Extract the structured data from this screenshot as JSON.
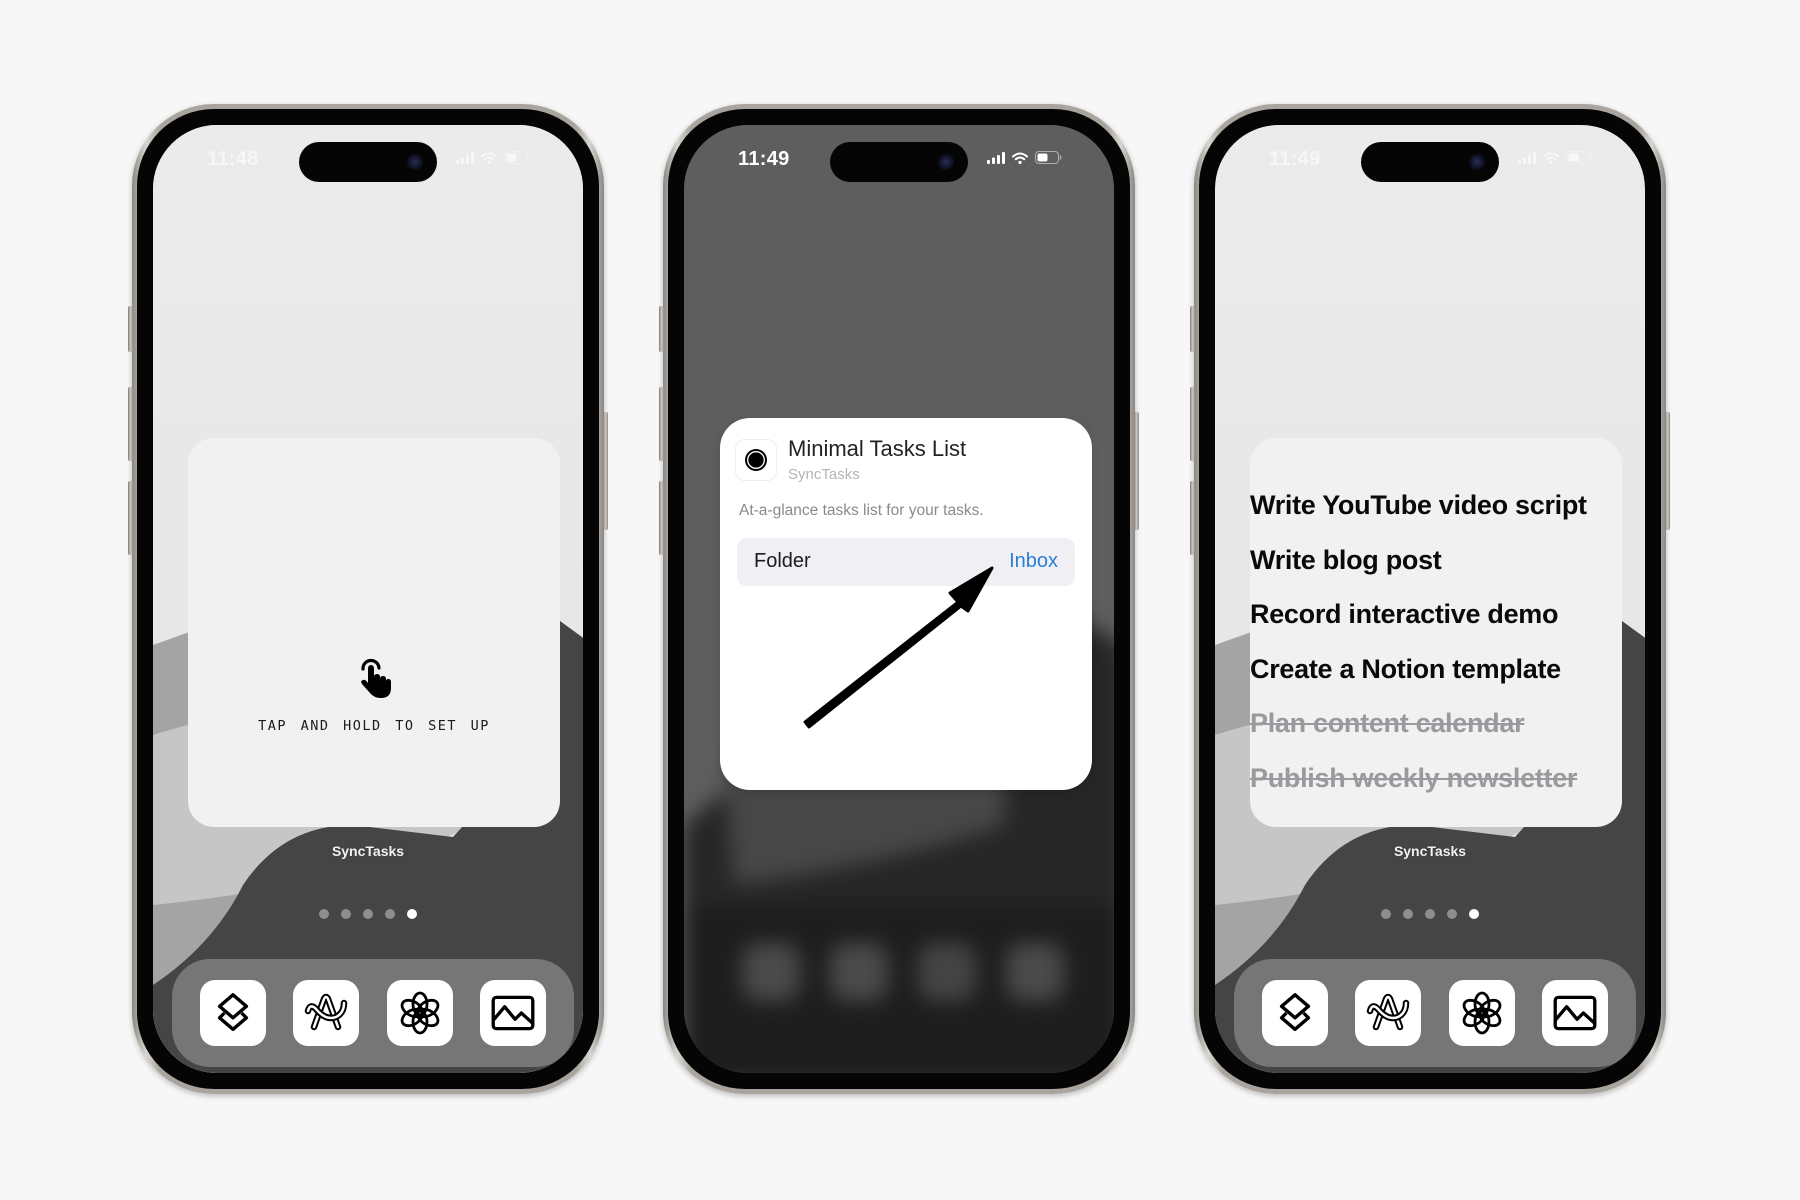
{
  "phones": [
    {
      "status": {
        "time": "11:48"
      },
      "widget": {
        "icon": "tap-hand-icon",
        "prompt": "TAP AND HOLD TO SET UP"
      },
      "widget_label": "SyncTasks",
      "page_dots": {
        "count": 5,
        "active_index": 4
      },
      "dock": [
        "layers-app-icon",
        "arc-app-icon",
        "chatgpt-app-icon",
        "photos-app-icon"
      ]
    },
    {
      "status": {
        "time": "11:49"
      },
      "config_sheet": {
        "title": "Minimal Tasks List",
        "app_name": "SyncTasks",
        "description": "At-a-glance tasks list for your tasks.",
        "folder_label": "Folder",
        "folder_value": "Inbox",
        "accent_color": "#2a7fd4"
      }
    },
    {
      "status": {
        "time": "11:49"
      },
      "tasks": [
        {
          "title": "Write YouTube video script",
          "done": false
        },
        {
          "title": "Write blog post",
          "done": false
        },
        {
          "title": "Record interactive demo",
          "done": false
        },
        {
          "title": "Create a Notion template",
          "done": false
        },
        {
          "title": "Plan content calendar",
          "done": true
        },
        {
          "title": "Publish weekly newsletter",
          "done": true
        }
      ],
      "widget_label": "SyncTasks",
      "page_dots": {
        "count": 5,
        "active_index": 4
      },
      "dock": [
        "layers-app-icon",
        "arc-app-icon",
        "chatgpt-app-icon",
        "photos-app-icon"
      ]
    }
  ]
}
